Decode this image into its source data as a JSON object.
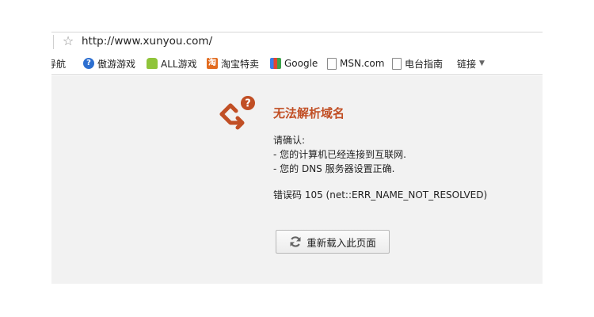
{
  "address_bar": {
    "url": "http://www.xunyou.com/"
  },
  "bookmarks": [
    {
      "label": "导航",
      "icon": "truncated"
    },
    {
      "label": "傲游游戏",
      "icon": "aoyou-icon"
    },
    {
      "label": "ALL游戏",
      "icon": "all-games-icon"
    },
    {
      "label": "淘宝特卖",
      "icon": "taobao-icon",
      "icon_text": "淘"
    },
    {
      "label": "Google",
      "icon": "google-icon"
    },
    {
      "label": "MSN.com",
      "icon": "page-icon"
    },
    {
      "label": "电台指南",
      "icon": "page-icon"
    },
    {
      "label": "链接",
      "icon": "chevron-down-icon"
    }
  ],
  "error": {
    "title": "无法解析域名",
    "confirm_heading": "请确认:",
    "checks": [
      "- 您的计算机已经连接到互联网.",
      "- 您的 DNS 服务器设置正确."
    ],
    "code_line": "错误码 105 (net::ERR_NAME_NOT_RESOLVED)",
    "accent_color": "#c14f25"
  },
  "reload_button": {
    "label": "重新载入此页面"
  }
}
